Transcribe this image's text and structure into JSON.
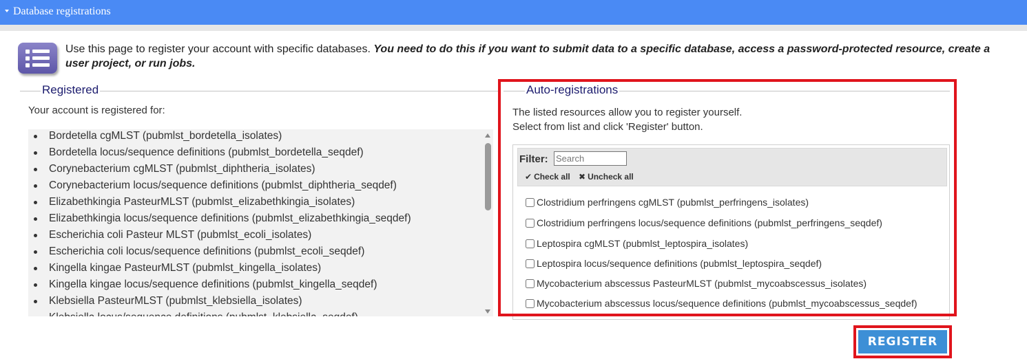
{
  "header": {
    "title": "Database registrations"
  },
  "intro": {
    "normal": "Use this page to register your account with specific databases. ",
    "bold": "You need to do this if you want to submit data to a specific database, access a password-protected resource, create a user project, or run jobs."
  },
  "registered": {
    "legend": "Registered",
    "label": "Your account is registered for:",
    "items": [
      "Bordetella cgMLST (pubmlst_bordetella_isolates)",
      "Bordetella locus/sequence definitions (pubmlst_bordetella_seqdef)",
      "Corynebacterium cgMLST (pubmlst_diphtheria_isolates)",
      "Corynebacterium locus/sequence definitions (pubmlst_diphtheria_seqdef)",
      "Elizabethkingia PasteurMLST (pubmlst_elizabethkingia_isolates)",
      "Elizabethkingia locus/sequence definitions (pubmlst_elizabethkingia_seqdef)",
      "Escherichia coli Pasteur MLST (pubmlst_ecoli_isolates)",
      "Escherichia coli locus/sequence definitions (pubmlst_ecoli_seqdef)",
      "Kingella kingae PasteurMLST (pubmlst_kingella_isolates)",
      "Kingella kingae locus/sequence definitions (pubmlst_kingella_seqdef)",
      "Klebsiella PasteurMLST (pubmlst_klebsiella_isolates)",
      "Klebsiella locus/sequence definitions (pubmlst_klebsiella_seqdef)"
    ]
  },
  "auto": {
    "legend": "Auto-registrations",
    "desc_line1": "The listed resources allow you to register yourself.",
    "desc_line2": "Select from list and click 'Register' button.",
    "filter_label": "Filter:",
    "filter_placeholder": "Search",
    "check_all": "Check all",
    "uncheck_all": "Uncheck all",
    "options": [
      "Clostridium perfringens cgMLST (pubmlst_perfringens_isolates)",
      "Clostridium perfringens locus/sequence definitions (pubmlst_perfringens_seqdef)",
      "Leptospira cgMLST (pubmlst_leptospira_isolates)",
      "Leptospira locus/sequence definitions (pubmlst_leptospira_seqdef)",
      "Mycobacterium abscessus PasteurMLST (pubmlst_mycoabscessus_isolates)",
      "Mycobacterium abscessus locus/sequence definitions (pubmlst_mycoabscessus_seqdef)"
    ]
  },
  "register_button": "REGISTER"
}
